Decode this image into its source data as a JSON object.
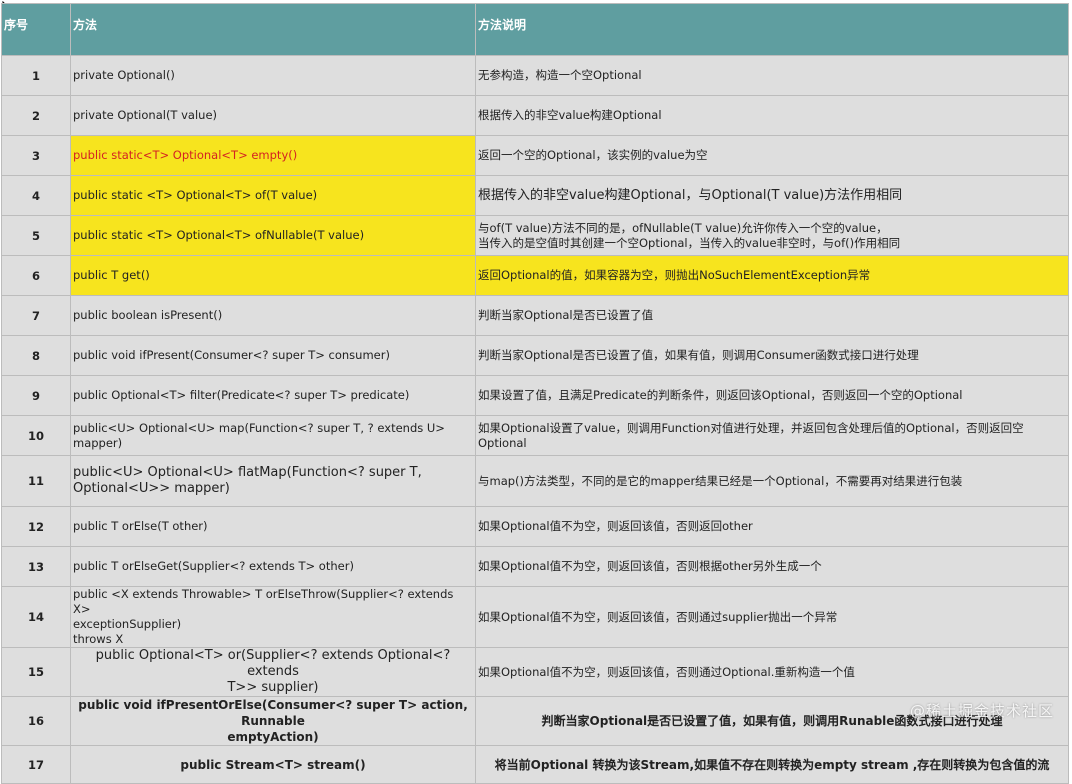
{
  "columns": [
    "序号",
    "方法",
    "方法说明"
  ],
  "rows": [
    {
      "num": "1",
      "method": "private Optional()",
      "desc": "无参构造，构造一个空Optional"
    },
    {
      "num": "2",
      "method": "private Optional(T value)",
      "desc": "根据传入的非空value构建Optional"
    },
    {
      "num": "3",
      "method": "public static<T> Optional<T> empty()",
      "desc": "返回一个空的Optional，该实例的value为空"
    },
    {
      "num": "4",
      "method": "public static <T> Optional<T> of(T value)",
      "desc": "根据传入的非空value构建Optional，与Optional(T value)方法作用相同"
    },
    {
      "num": "5",
      "method": "public static <T> Optional<T> ofNullable(T value)",
      "desc": "与of(T value)方法不同的是，ofNullable(T value)允许你传入一个空的value，\n当传入的是空值时其创建一个空Optional，当传入的value非空时，与of()作用相同"
    },
    {
      "num": "6",
      "method": "public T get()",
      "desc": "返回Optional的值，如果容器为空，则抛出NoSuchElementException异常"
    },
    {
      "num": "7",
      "method": "public boolean isPresent()",
      "desc": "判断当家Optional是否已设置了值"
    },
    {
      "num": "8",
      "method": "public void ifPresent(Consumer<? super T> consumer)",
      "desc": "判断当家Optional是否已设置了值，如果有值，则调用Consumer函数式接口进行处理"
    },
    {
      "num": "9",
      "method": "public Optional<T> filter(Predicate<? super T> predicate)",
      "desc": "如果设置了值，且满足Predicate的判断条件，则返回该Optional，否则返回一个空的Optional"
    },
    {
      "num": "10",
      "method": "public<U> Optional<U> map(Function<? super T, ? extends U> mapper)",
      "desc": "如果Optional设置了value，则调用Function对值进行处理，并返回包含处理后值的Optional，否则返回空\nOptional"
    },
    {
      "num": "11",
      "method": "public<U> Optional<U> flatMap(Function<? super T,\nOptional<U>> mapper)",
      "desc": "与map()方法类型，不同的是它的mapper结果已经是一个Optional，不需要再对结果进行包装"
    },
    {
      "num": "12",
      "method": "public T orElse(T other)",
      "desc": "如果Optional值不为空，则返回该值，否则返回other"
    },
    {
      "num": "13",
      "method": "public T orElseGet(Supplier<? extends T> other)",
      "desc": "如果Optional值不为空，则返回该值，否则根据other另外生成一个"
    },
    {
      "num": "14",
      "method": "public <X extends Throwable> T orElseThrow(Supplier<? extends X>\nexceptionSupplier)\nthrows X",
      "desc": "如果Optional值不为空，则返回该值，否则通过supplier抛出一个异常"
    },
    {
      "num": "15",
      "method": "public Optional<T> or(Supplier<? extends Optional<? extends\nT>> supplier)",
      "desc": "如果Optional值不为空，则返回该值，否则通过Optional.重新构造一个值"
    },
    {
      "num": "16",
      "method": "public void ifPresentOrElse(Consumer<? super T> action, Runnable\nemptyAction)",
      "desc": "判断当家Optional是否已设置了值，如果有值，则调用Runable函数式接口进行处理"
    },
    {
      "num": "17",
      "method": "public Stream<T> stream()",
      "desc": "将当前Optional 转换为该Stream,如果值不存在则转换为empty stream ,存在则转换为包含值的流"
    }
  ],
  "watermark": "@稀土掘金技术社区",
  "colors": {
    "header": "#5f9ea0",
    "highlight": "#f7e41e",
    "cell": "#dedede",
    "red_text": "#d42222"
  },
  "icons": {
    "cursor": "mouse-pointer-icon"
  }
}
